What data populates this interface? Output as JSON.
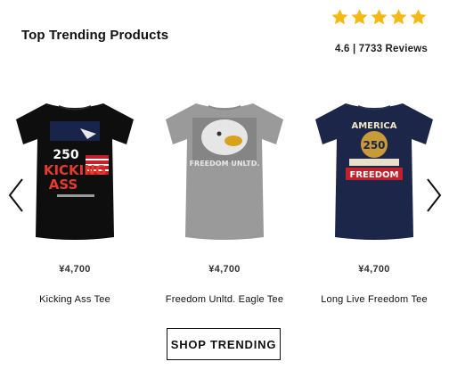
{
  "section": {
    "title": "Top Trending Products",
    "rating_text": "4.6 | 7733 Reviews",
    "stars_filled": 5,
    "star_color": "#f5b916"
  },
  "products": [
    {
      "price": "¥4,700",
      "name": "Kicking Ass Tee",
      "shirt_color": "#0e0e0e",
      "print_text": [
        "250",
        "KICKING",
        "ASS"
      ]
    },
    {
      "price": "¥4,700",
      "name": "Freedom Unltd. Eagle Tee",
      "shirt_color": "#9a9a9a",
      "print_text": [
        "FREEDOM UNLTD."
      ]
    },
    {
      "price": "¥4,700",
      "name": "Long Live Freedom Tee",
      "shirt_color": "#1c2648",
      "print_text": [
        "AMERICA",
        "250",
        "FREEDOM"
      ]
    }
  ],
  "cta": {
    "label": "SHOP TRENDING"
  },
  "icons": {
    "prev": "chevron-left-icon",
    "next": "chevron-right-icon",
    "star": "star-icon"
  }
}
